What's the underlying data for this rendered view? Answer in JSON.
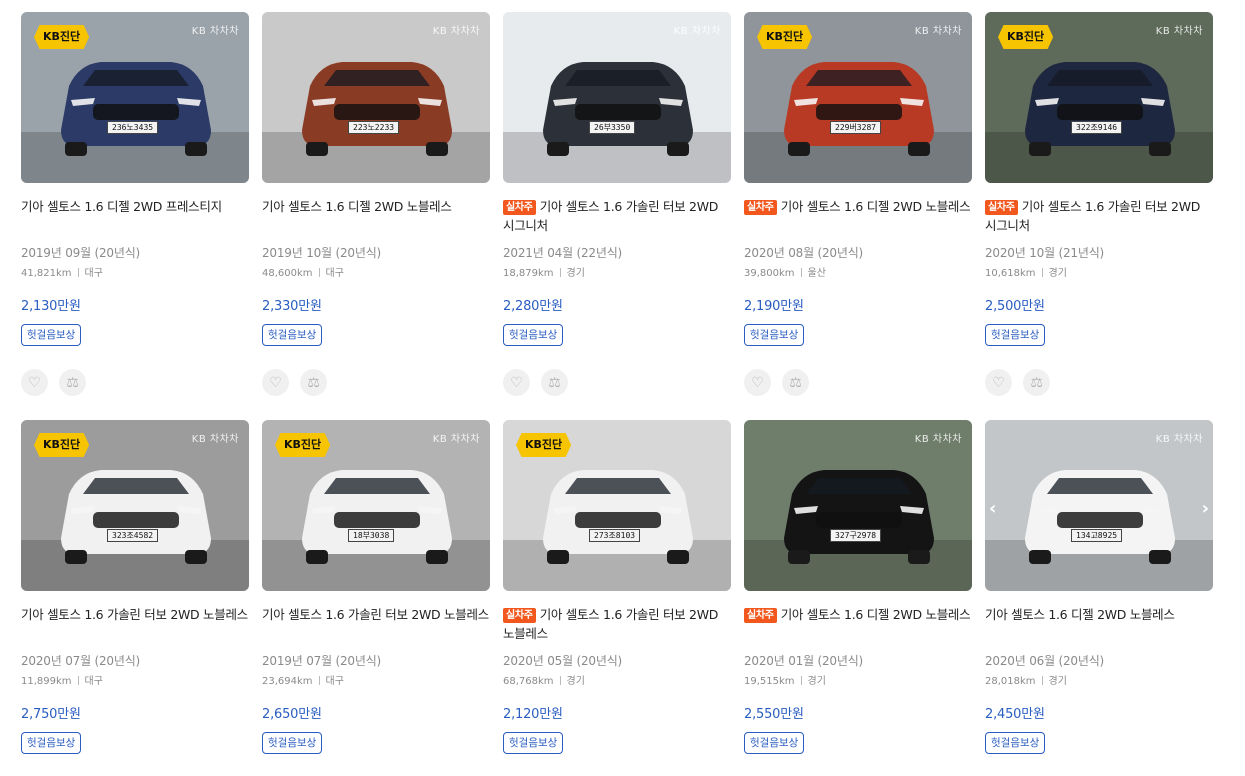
{
  "colors": {
    "price": "#2a5dc1",
    "badge_kb": "#f6c400",
    "badge_real": "#f2581e"
  },
  "icons": {
    "like": "heart-icon",
    "compare": "scale-icon"
  },
  "cars": [
    {
      "title": "기아 셀토스 1.6 디젤 2WD 프레스티지",
      "real_badge": "",
      "year": "2019년 09월 (20년식)",
      "mileage": "41,821km",
      "region": "대구",
      "price": "2,130만원",
      "tag": "헛걸음보상",
      "kb_badge": "KB진단",
      "watermark": "KB 차차차",
      "plate": "236노3435",
      "body_color": "#2b3a66",
      "bg": "#9aa3aa"
    },
    {
      "title": "기아 셀토스 1.6 디젤 2WD 노블레스",
      "real_badge": "",
      "year": "2019년 10월 (20년식)",
      "mileage": "48,600km",
      "region": "대구",
      "price": "2,330만원",
      "tag": "헛걸음보상",
      "kb_badge": "",
      "watermark": "KB 차차차",
      "plate": "223노2233",
      "body_color": "#8a3b24",
      "bg": "#c9c9c9"
    },
    {
      "title": "기아 셀토스 1.6 가솔린 터보 2WD 시그니처",
      "real_badge": "실차주",
      "year": "2021년 04월 (22년식)",
      "mileage": "18,879km",
      "region": "경기",
      "price": "2,280만원",
      "tag": "헛걸음보상",
      "kb_badge": "",
      "watermark": "KB 차차차",
      "plate": "26부3350",
      "body_color": "#2c3038",
      "bg": "#e8ebee"
    },
    {
      "title": "기아 셀토스 1.6 디젤 2WD 노블레스",
      "real_badge": "실차주",
      "year": "2020년 08월 (20년식)",
      "mileage": "39,800km",
      "region": "울산",
      "price": "2,190만원",
      "tag": "헛걸음보상",
      "kb_badge": "KB진단",
      "watermark": "KB 차차차",
      "plate": "229버3287",
      "body_color": "#b83a24",
      "bg": "#8f959b"
    },
    {
      "title": "기아 셀토스 1.6 가솔린 터보 2WD 시그니처",
      "real_badge": "실차주",
      "year": "2020년 10월 (21년식)",
      "mileage": "10,618km",
      "region": "경기",
      "price": "2,500만원",
      "tag": "헛걸음보상",
      "kb_badge": "KB진단",
      "watermark": "KB 차차차",
      "plate": "322조9146",
      "body_color": "#1e2740",
      "bg": "#5e6b5a"
    },
    {
      "title": "기아 셀토스 1.6 가솔린 터보 2WD 노블레스",
      "real_badge": "",
      "year": "2020년 07월 (20년식)",
      "mileage": "11,899km",
      "region": "대구",
      "price": "2,750만원",
      "tag": "헛걸음보상",
      "kb_badge": "KB진단",
      "watermark": "KB 차차차",
      "plate": "323조4582",
      "body_color": "#f1f1f1",
      "bg": "#9c9c9c"
    },
    {
      "title": "기아 셀토스 1.6 가솔린 터보 2WD 노블레스",
      "real_badge": "",
      "year": "2019년 07월 (20년식)",
      "mileage": "23,694km",
      "region": "대구",
      "price": "2,650만원",
      "tag": "헛걸음보상",
      "kb_badge": "KB진단",
      "watermark": "KB 차차차",
      "plate": "18부3038",
      "body_color": "#f1f1f1",
      "bg": "#b3b3b3"
    },
    {
      "title": "기아 셀토스 1.6 가솔린 터보 2WD 노블레스",
      "real_badge": "실차주",
      "year": "2020년 05월 (20년식)",
      "mileage": "68,768km",
      "region": "경기",
      "price": "2,120만원",
      "tag": "헛걸음보상",
      "kb_badge": "KB진단",
      "watermark": "",
      "plate": "273조8103",
      "body_color": "#f1f1f1",
      "bg": "#d7d7d7"
    },
    {
      "title": "기아 셀토스 1.6 디젤 2WD 노블레스",
      "real_badge": "실차주",
      "year": "2020년 01월 (20년식)",
      "mileage": "19,515km",
      "region": "경기",
      "price": "2,550만원",
      "tag": "헛걸음보상",
      "kb_badge": "",
      "watermark": "KB 차차차",
      "plate": "327구2978",
      "body_color": "#141414",
      "bg": "#6f7d6b"
    },
    {
      "title": "기아 셀토스 1.6 디젤 2WD 노블레스",
      "real_badge": "",
      "year": "2020년 06월 (20년식)",
      "mileage": "28,018km",
      "region": "경기",
      "price": "2,450만원",
      "tag": "헛걸음보상",
      "kb_badge": "",
      "watermark": "KB 차차차",
      "plate": "134고8925",
      "body_color": "#f4f4f4",
      "bg": "#c3c6c8",
      "arrows": true
    }
  ]
}
